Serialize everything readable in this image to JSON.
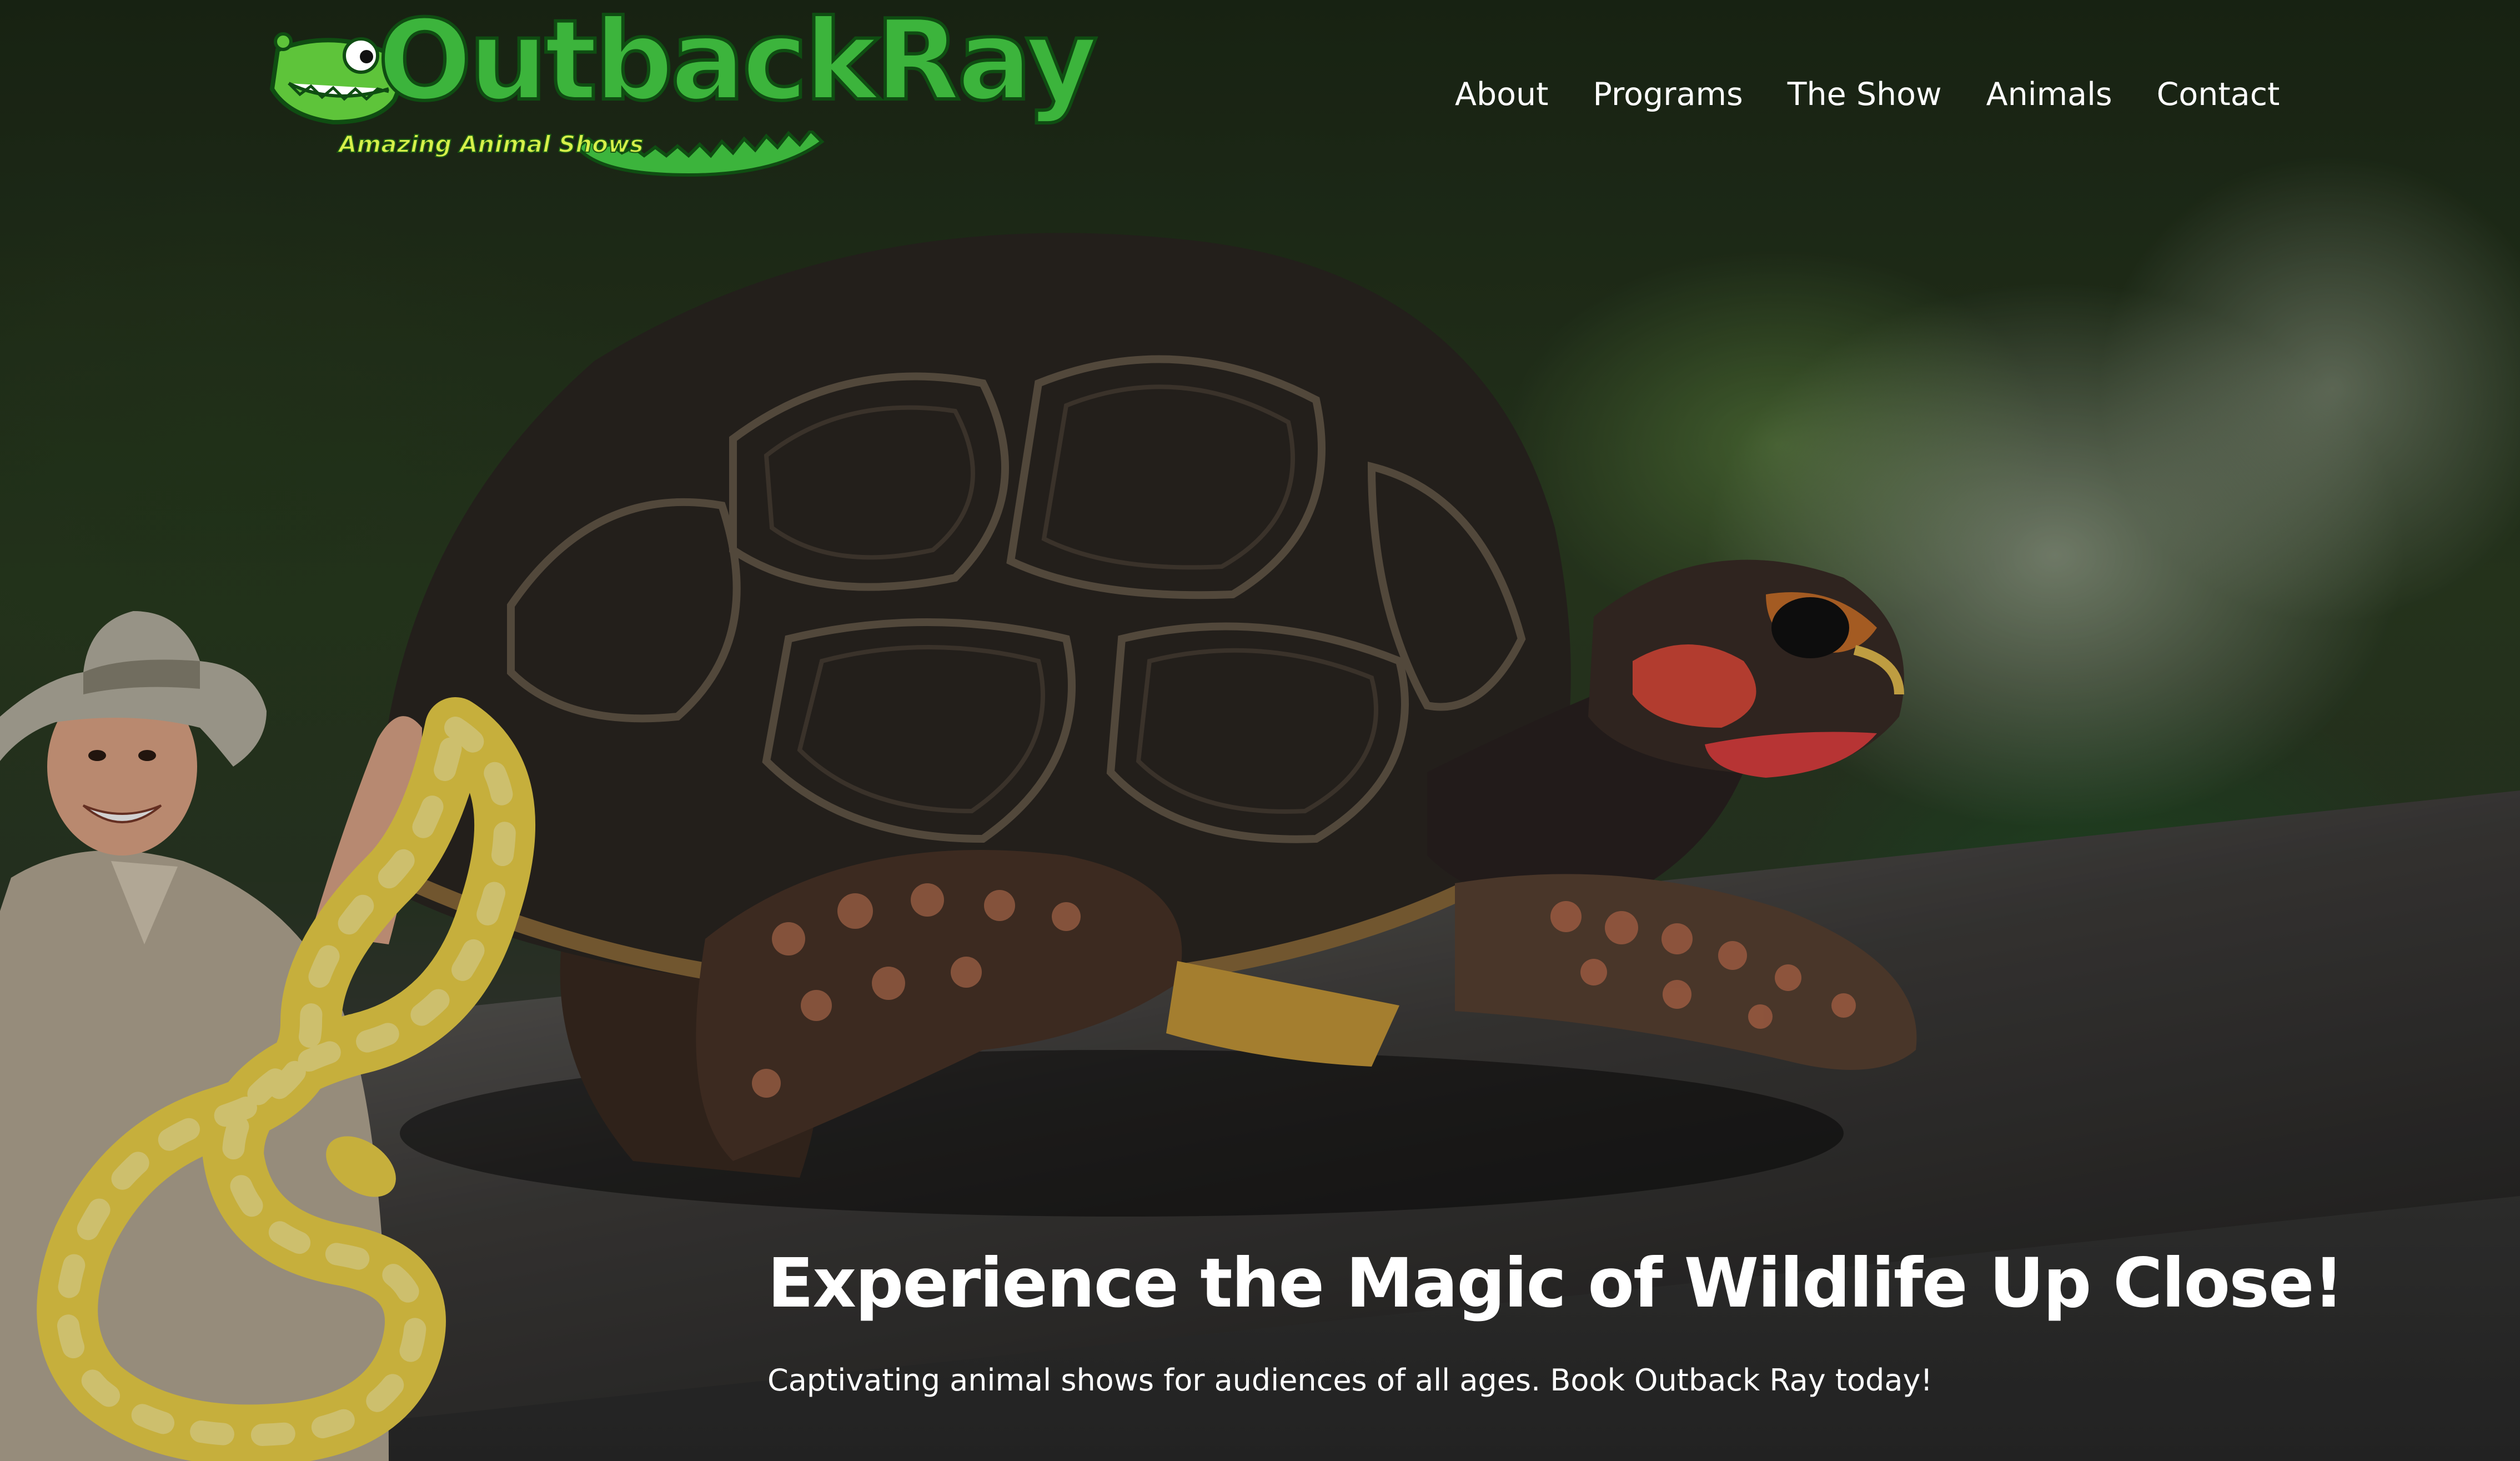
{
  "header": {
    "logo_text": "OutbackRay",
    "logo_tagline": "Amazing Animal Shows",
    "logo_icon": "crocodile-icon"
  },
  "nav": {
    "items": [
      {
        "label": "About"
      },
      {
        "label": "Programs"
      },
      {
        "label": "The Show"
      },
      {
        "label": "Animals"
      },
      {
        "label": "Contact"
      }
    ]
  },
  "hero": {
    "title": "Experience the Magic of Wildlife Up Close!",
    "subtitle": "Captivating animal shows for audiences of all ages. Book Outback Ray today!"
  },
  "colors": {
    "logo_green": "#3cb43c",
    "logo_dark_green": "#0f4d12",
    "tagline_yellow": "#d7f04a",
    "nav_text": "#ffffff"
  }
}
